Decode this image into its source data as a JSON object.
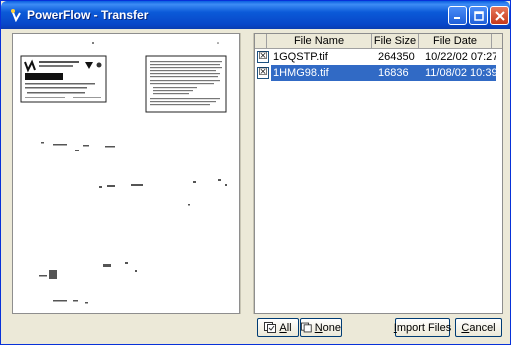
{
  "window": {
    "title": "PowerFlow - Transfer"
  },
  "file_list": {
    "columns": [
      "File Name",
      "File Size",
      "File Date"
    ],
    "rows": [
      {
        "checked": "☒",
        "name": "1GQSTP.tif",
        "size": "264350",
        "date": "10/22/02 07:27",
        "selected": false
      },
      {
        "checked": "☒",
        "name": "1HMG98.tif",
        "size": "16836",
        "date": "11/08/02 10:39",
        "selected": true
      }
    ]
  },
  "buttons": {
    "all_mnemonic": "A",
    "all_rest": "ll",
    "none_mnemonic": "N",
    "none_rest": "one",
    "import_mnemonic": "I",
    "import_rest": "mport Files",
    "cancel_mnemonic": "C",
    "cancel_rest": "ancel"
  },
  "colors": {
    "titlebar": "#0a5fe0",
    "selection": "#316ac5",
    "face": "#ece9d8"
  },
  "icons": [
    "app-icon",
    "minimize-icon",
    "maximize-icon",
    "close-icon",
    "select-all-icon",
    "select-none-icon"
  ]
}
